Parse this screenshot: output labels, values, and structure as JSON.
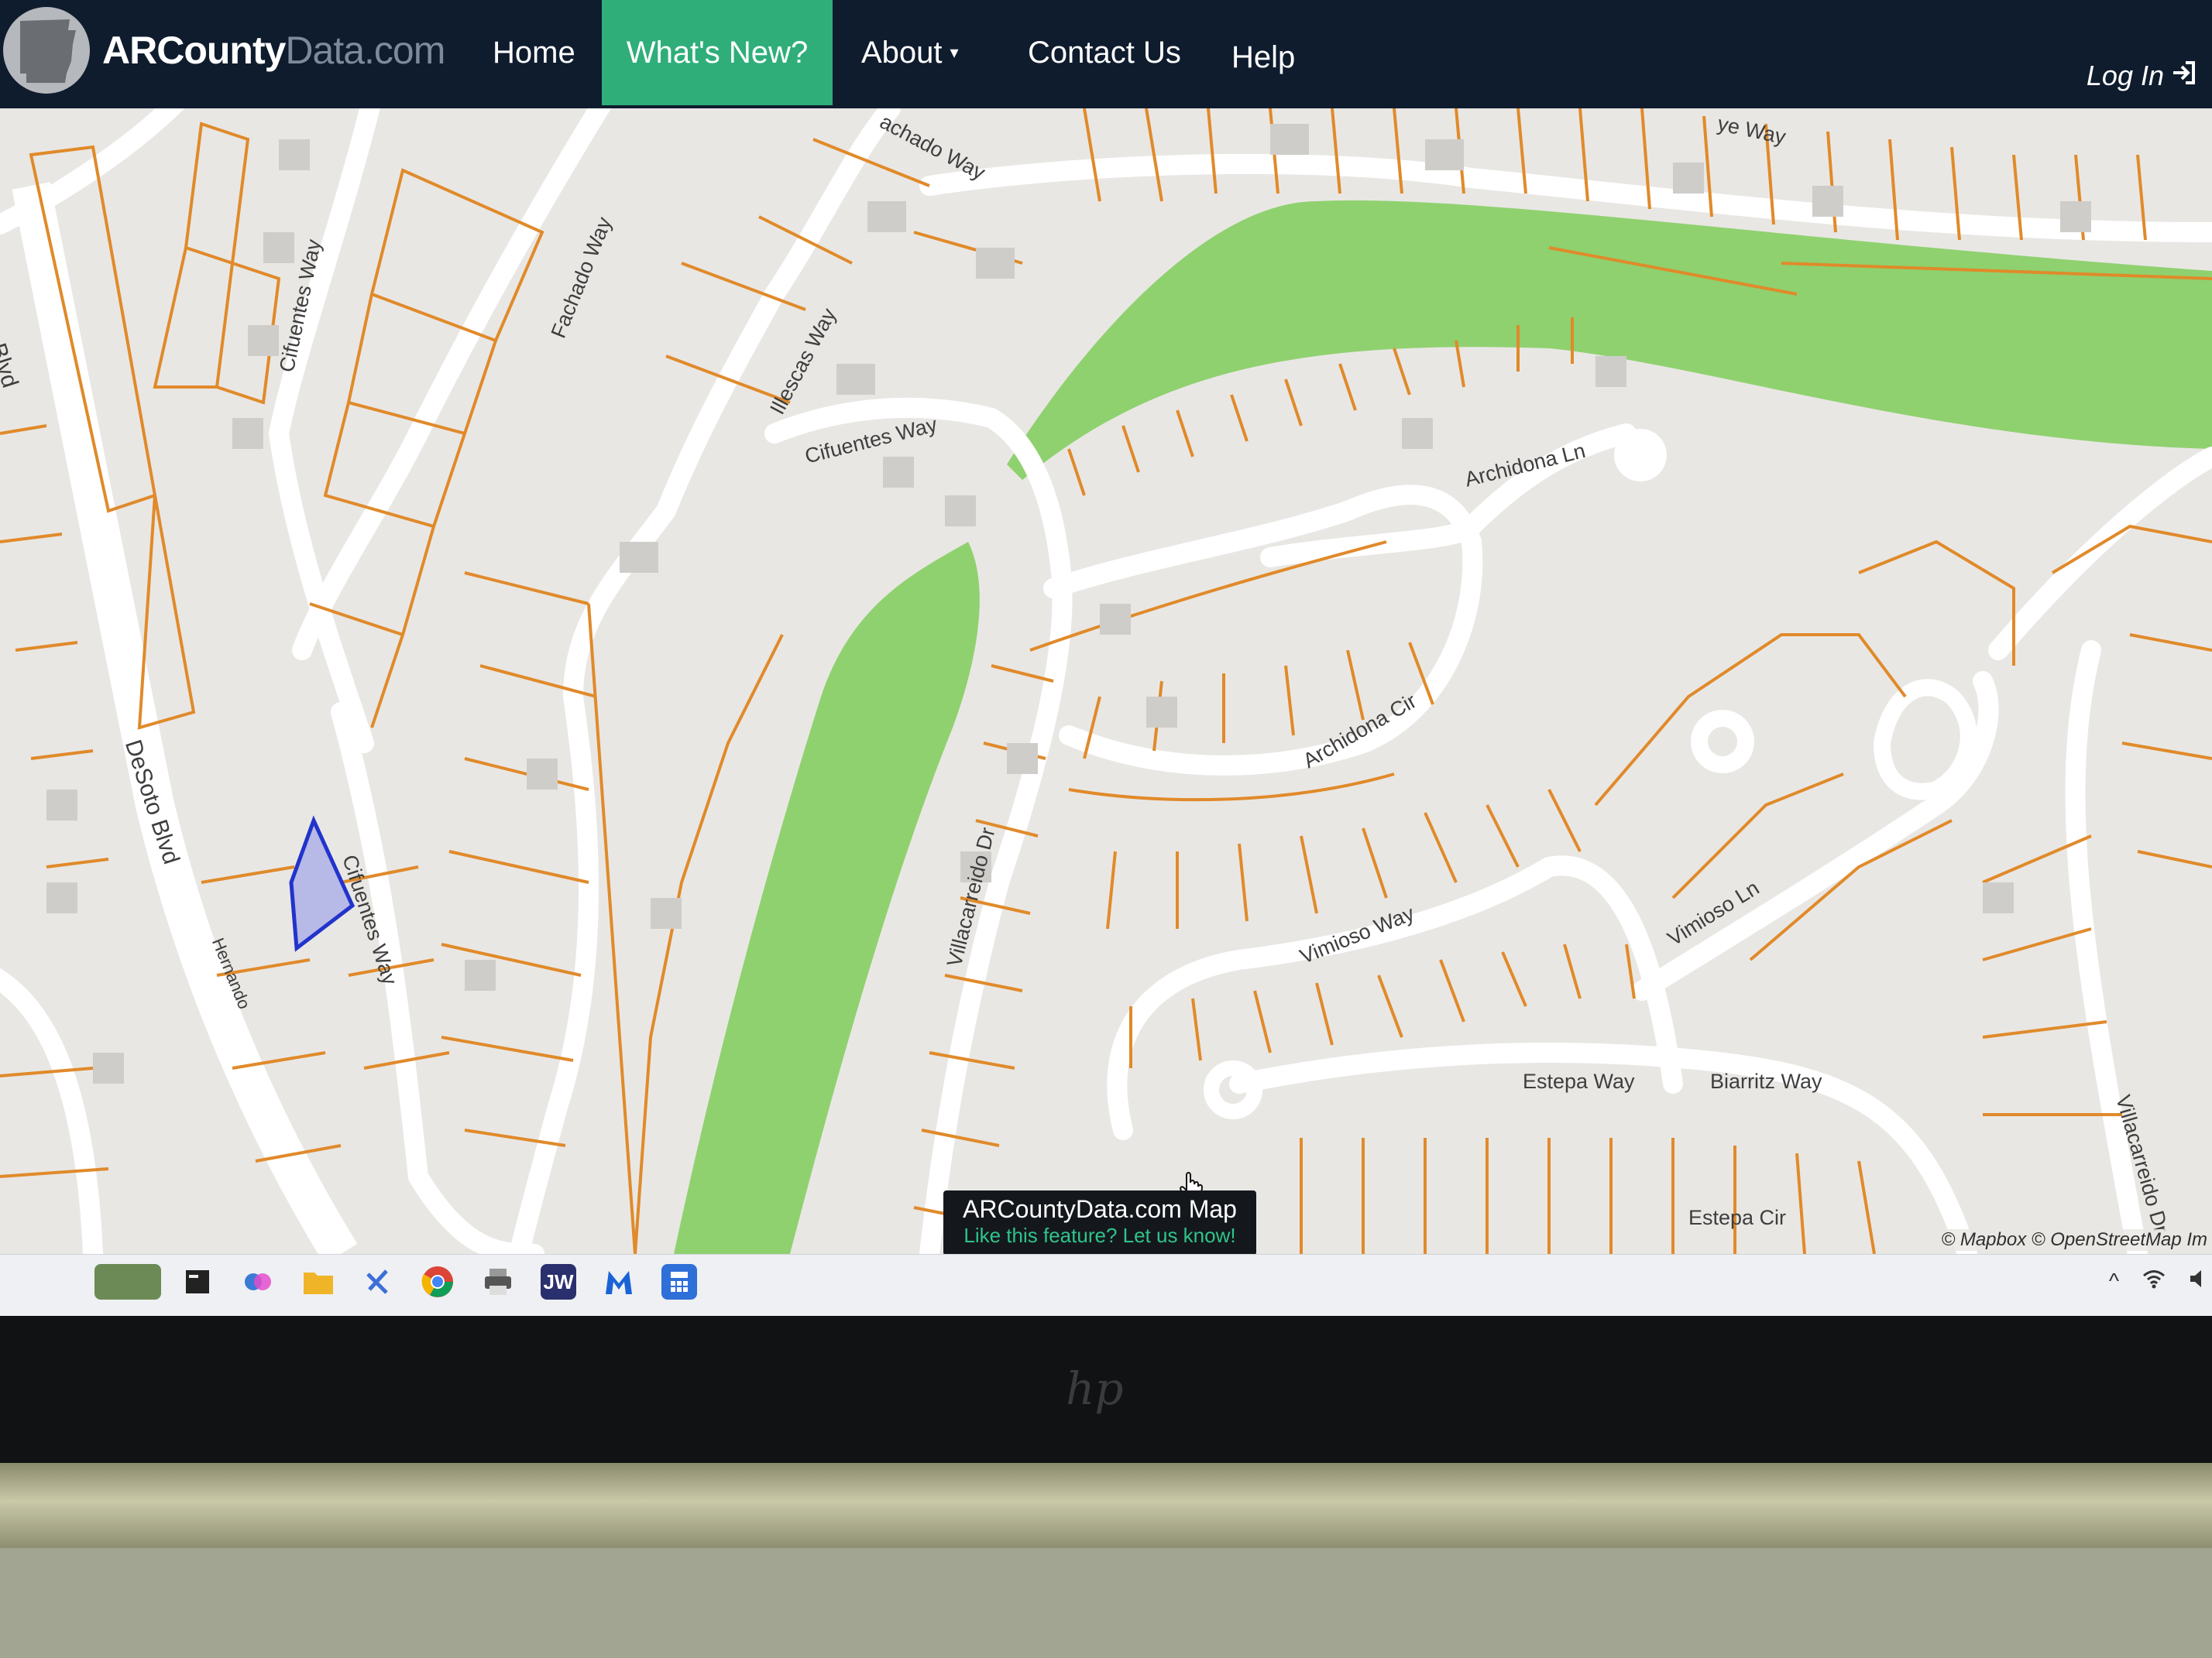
{
  "navbar": {
    "brand_main": "ARCounty",
    "brand_domain": "Data.com",
    "items": [
      {
        "label": "Home"
      },
      {
        "label": "What's New?"
      },
      {
        "label": "About"
      },
      {
        "label": "Contact Us"
      },
      {
        "label": "Help"
      }
    ],
    "about_caret": "▾",
    "login_label": "Log In",
    "active_color": "#2fae7a",
    "bg_color": "#0f1c2e"
  },
  "map": {
    "street_labels": [
      "Cifuentes Way",
      "Fachado Way",
      "Illescas Way",
      "Cifuentes Way",
      "Archidona Ln",
      "Archidona Cir",
      "Villacarreido Dr",
      "Vimioso Way",
      "Vimioso Ln",
      "Estepa Way",
      "Biarritz Way",
      "Estepa Cir",
      "Villacarreido Dr",
      "DeSoto Blvd",
      "oto Blvd",
      "Cifuentes Way",
      "Hernando",
      "achado Way",
      "ye Way"
    ],
    "parcel_color": "#e08a2a",
    "park_color": "#8fd16f",
    "selected_parcel_color": "#2233cc",
    "popup": {
      "title": "ARCountyData.com Map",
      "link": "Like this feature? Let us know!"
    },
    "attribution": "© Mapbox © OpenStreetMap  Im"
  },
  "taskbar": {
    "icons": [
      "widgets-icon",
      "terminal-icon",
      "copilot-icon",
      "file-explorer-icon",
      "snipping-tool-icon",
      "chrome-icon",
      "printer-icon",
      "jw-icon",
      "malwarebytes-icon",
      "calculator-icon"
    ],
    "jw_label": "JW",
    "tray_arrow": "^"
  },
  "laptop": {
    "logo": "hp"
  }
}
